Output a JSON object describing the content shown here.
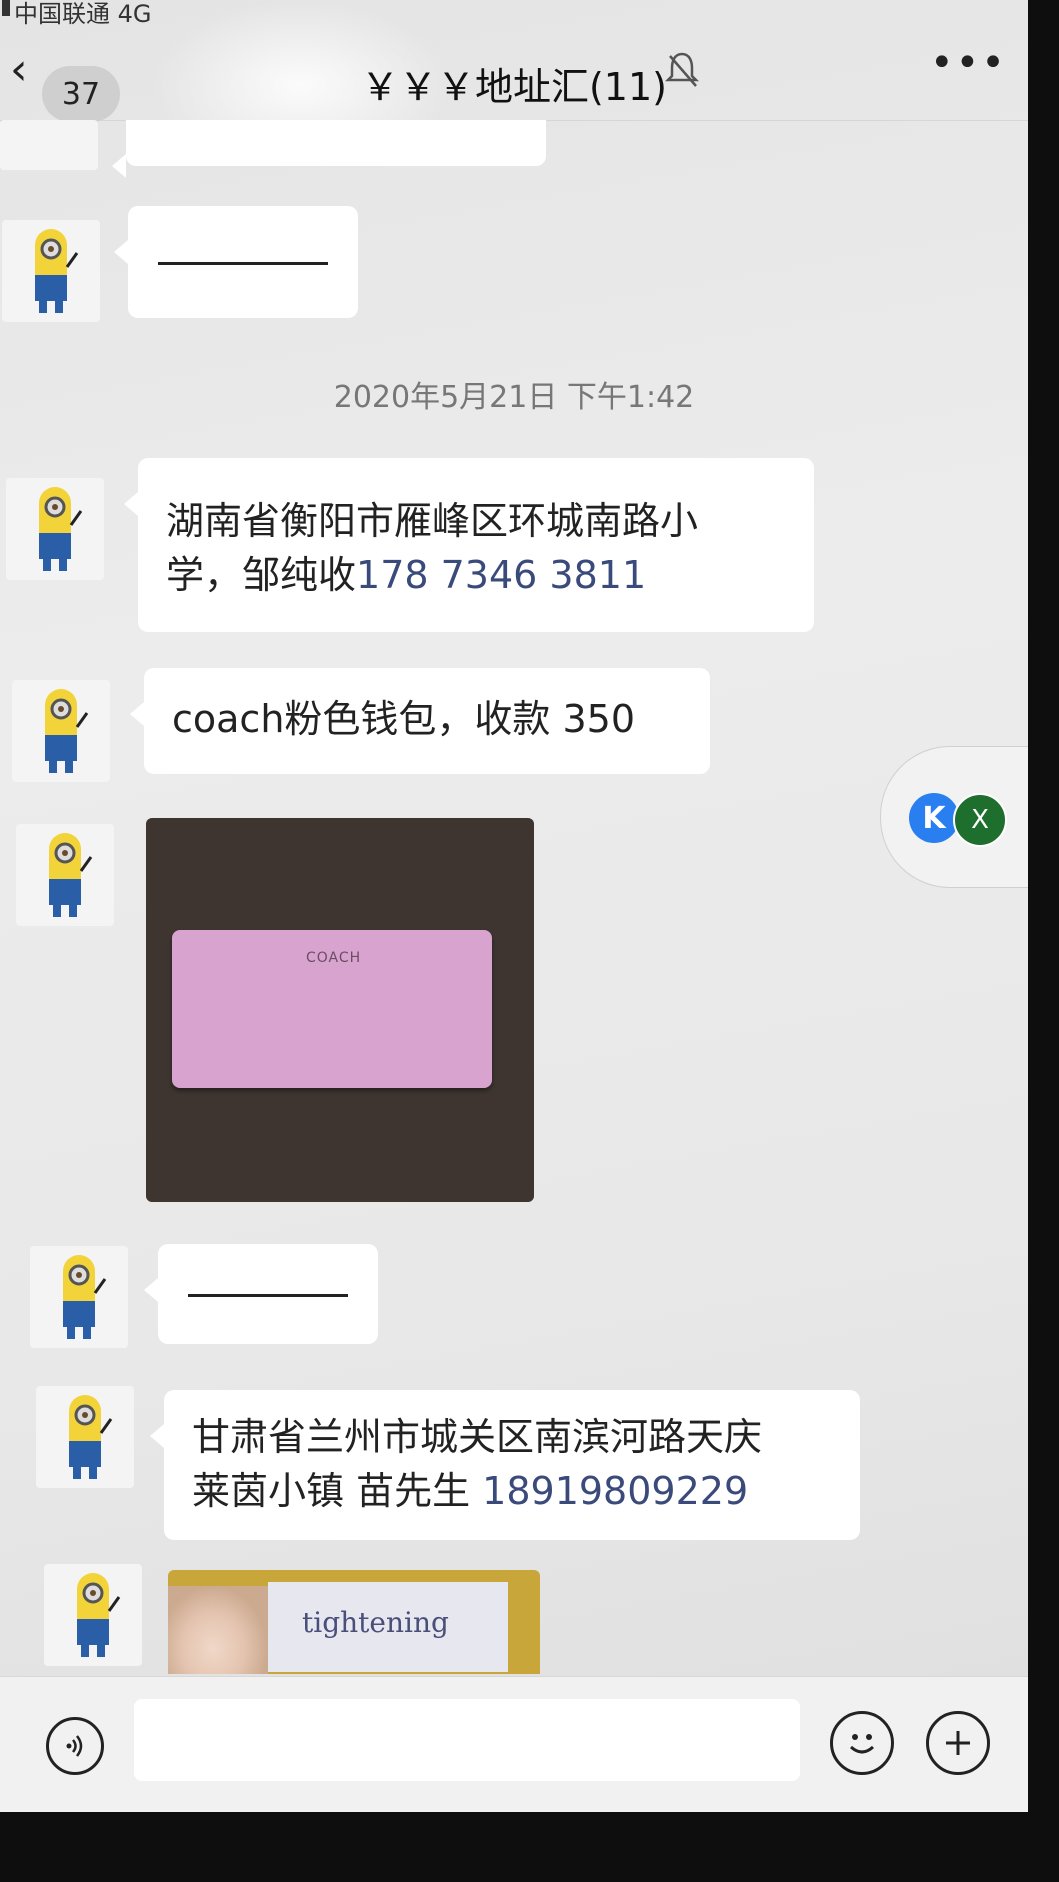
{
  "status_bar": {
    "carrier": "中国联通 4G"
  },
  "nav": {
    "unread_count": "37",
    "title": "￥￥￥地址汇(11)",
    "muted_icon": "bell-slash-icon",
    "more_icon": "more-dots-icon"
  },
  "messages": [
    {
      "type": "text",
      "text": "——————"
    },
    {
      "type": "timestamp",
      "text": "2020年5月21日 下午1:42"
    },
    {
      "type": "text",
      "line1": "湖南省衡阳市雁峰区环城南路小",
      "line2_prefix": "学，邹纯收",
      "phone": "178 7346 3811"
    },
    {
      "type": "text",
      "text": "coach粉色钱包，收款 350"
    },
    {
      "type": "image",
      "subject": "pink wallet",
      "brand_text": "COACH"
    },
    {
      "type": "text",
      "text": "——————"
    },
    {
      "type": "text",
      "line1": "甘肃省兰州市城关区南滨河路天庆",
      "line2_prefix": "莱茵小镇 苗先生 ",
      "phone": "18919809229"
    },
    {
      "type": "image",
      "subject": "product box",
      "visible_text": "tightening"
    }
  ],
  "floating_widget": {
    "left_badge": "K",
    "right_badge": "X"
  },
  "input_bar": {
    "voice_icon": "voice-icon",
    "emoji_icon": "emoji-icon",
    "plus_icon": "plus-icon"
  }
}
